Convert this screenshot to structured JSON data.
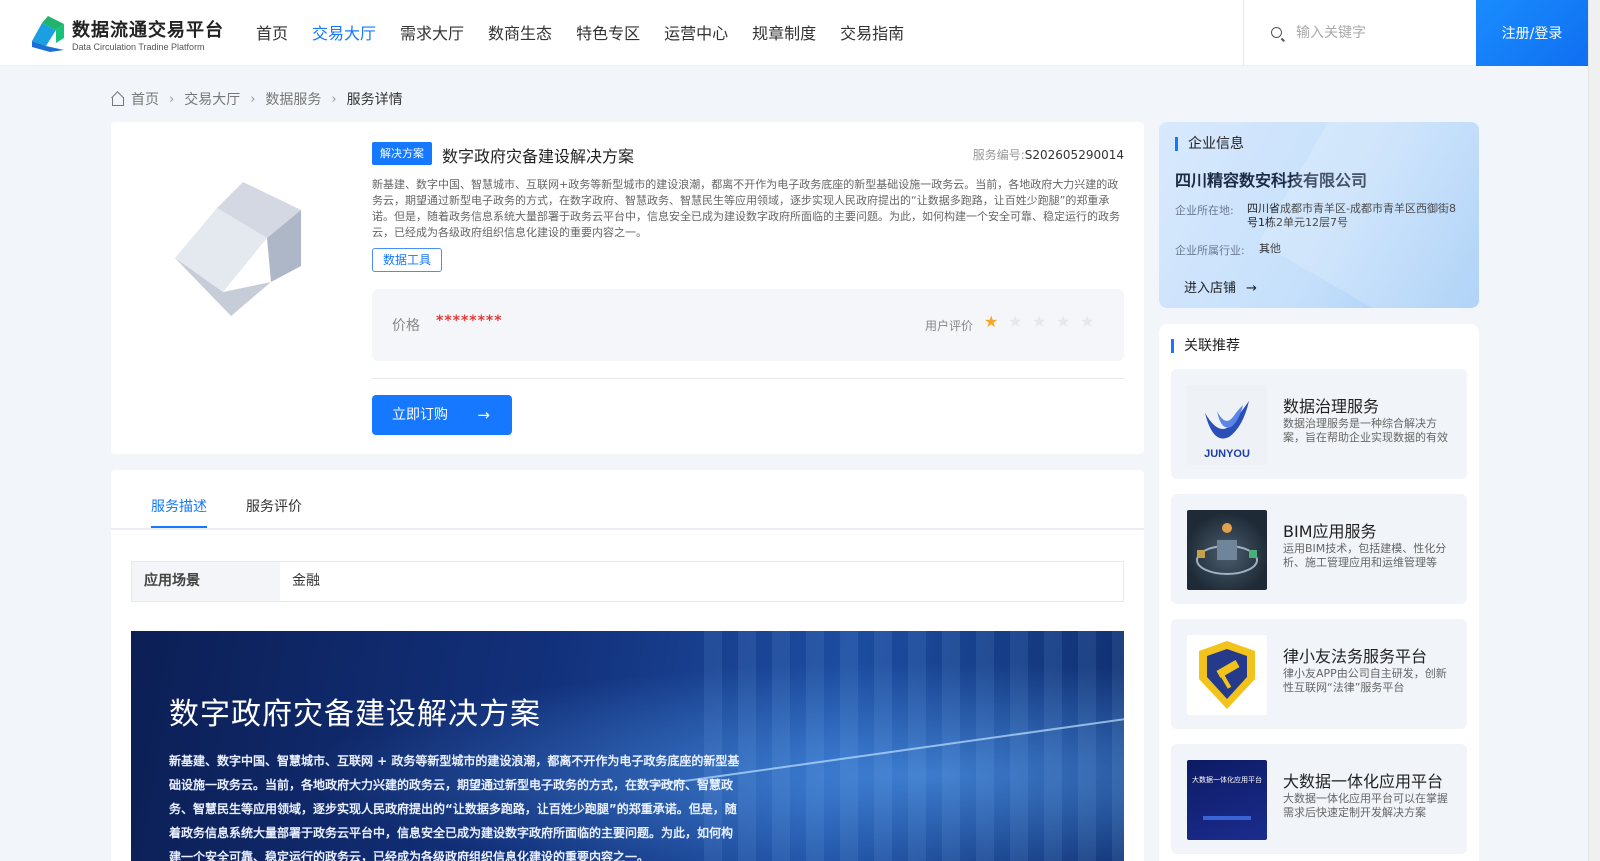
{
  "header": {
    "logo_title": "数据流通交易平台",
    "logo_subtitle": "Data Circulation Tradine Platform",
    "nav": [
      "首页",
      "交易大厅",
      "需求大厅",
      "数商生态",
      "特色专区",
      "运营中心",
      "规章制度",
      "交易指南"
    ],
    "active_nav": "交易大厅",
    "search_placeholder": "输入关键字",
    "login_label": "注册/登录"
  },
  "breadcrumb": {
    "home": "首页",
    "items": [
      "交易大厅",
      "数据服务"
    ],
    "current": "服务详情"
  },
  "product": {
    "tag": "解决方案",
    "title": "数字政府灾备建设解决方案",
    "service_no_label": "服务编号:",
    "service_no": "S202605290014",
    "description": "新基建、数字中国、智慧城市、互联网+政务等新型城市的建设浪潮，都离不开作为电子政务底座的新型基础设施一政务云。当前，各地政府大力兴建的政务云，期望通过新型电子政务的方式，在数字政府、智慧政务、智慧民生等应用领域，逐步实现人民政府提出的“让数据多跑路，让百姓少跑腿”的郑重承诺。但是，随着政务信息系统大量部署于政务云平台中，信息安全已成为建设数字政府所面临的主要问题。为此，如何构建一个安全可靠、稳定运行的政务云，已经成为各级政府组织信息化建设的重要内容之一。",
    "category_tag": "数据工具",
    "price_label": "价格",
    "price_value": "********",
    "rating_label": "用户评价",
    "rating": 1,
    "rating_max": 5,
    "buy_label": "立即订购",
    "accent_color": "#1677ff"
  },
  "tabs": {
    "items": [
      "服务描述",
      "服务评价"
    ],
    "active": "服务描述"
  },
  "details": {
    "scene_label": "应用场景",
    "scene_value": "金融",
    "banner_title": "数字政府灾备建设解决方案",
    "banner_text": "新基建、数字中国、智慧城市、互联网 + 政务等新型城市的建设浪潮，都离不开作为电子政务底座的新型基础设施一政务云。当前，各地政府大力兴建的政务云，期望通过新型电子政务的方式，在数字政府、智慧政务、智慧民生等应用领域，逐步实现人民政府提出的“让数据多跑路，让百姓少跑腿”的郑重承诺。但是，随着政务信息系统大量部署于政务云平台中，信息安全已成为建设数字政府所面临的主要问题。为此，如何构建一个安全可靠、稳定运行的政务云，已经成为各级政府组织信息化建设的重要内容之一。"
  },
  "company": {
    "section_title": "企业信息",
    "name": "四川精容数安科技有限公司",
    "location_label": "企业所在地:",
    "location": "四川省成都市青羊区-成都市青羊区西御街8号1栋2单元12层7号",
    "industry_label": "企业所属行业:",
    "industry": "其他",
    "shop_link": "进入店铺"
  },
  "recommend": {
    "section_title": "关联推荐",
    "items": [
      {
        "title": "数据治理服务",
        "desc": "数据治理服务是一种综合解决方案，旨在帮助企业实现数据的有效管理",
        "image_text": "JUNYOU"
      },
      {
        "title": "BIM应用服务",
        "desc": "运用BIM技术，包括建模、性化分析、施工管理应用和运维管理等"
      },
      {
        "title": "律小友法务服务平台",
        "desc": "律小友APP由公司自主研发，创新性互联网“法律”服务平台"
      },
      {
        "title": "大数据一体化应用平台",
        "desc": "大数据一体化应用平台可以在掌握需求后快速定制开发解决方案",
        "image_text": "大数据一体化应用平台"
      }
    ]
  }
}
